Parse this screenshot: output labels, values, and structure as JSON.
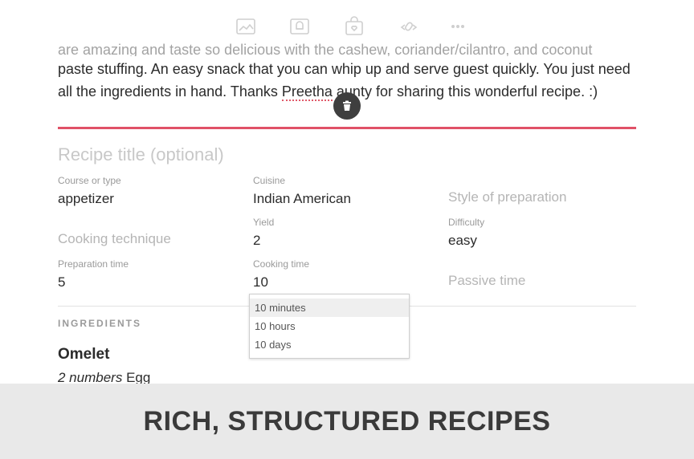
{
  "toolbar": {
    "buttons": [
      {
        "icon": "image-icon"
      },
      {
        "icon": "recipe-card-icon"
      },
      {
        "icon": "shopping-bag-icon"
      },
      {
        "icon": "link-icon"
      },
      {
        "icon": "more-icon"
      }
    ]
  },
  "paragraph": {
    "line1": "are amazing and taste so delicious with the cashew, coriander/cilantro, and coconut",
    "line2": "paste stuffing. An easy snack that you can whip up and serve guest quickly. You just need",
    "line3_before": "all the ingredients in hand. Thanks ",
    "line3_link": "Preetha",
    "line3_after": " aunty for sharing this wonderful recipe. :)"
  },
  "recipe": {
    "title_placeholder": "Recipe title (optional)",
    "course": {
      "label": "Course or type",
      "value": "appetizer"
    },
    "cuisine": {
      "label": "Cuisine",
      "value": "Indian American"
    },
    "style": {
      "placeholder": "Style of preparation"
    },
    "technique": {
      "placeholder": "Cooking technique"
    },
    "yield": {
      "label": "Yield",
      "value": "2"
    },
    "difficulty": {
      "label": "Difficulty",
      "value": "easy"
    },
    "prep_time": {
      "label": "Preparation time",
      "value": "5"
    },
    "cook_time": {
      "label": "Cooking time",
      "value": "10"
    },
    "passive_time": {
      "placeholder": "Passive time"
    }
  },
  "dropdown": {
    "options": [
      "10 minutes",
      "10 hours",
      "10 days"
    ],
    "selected_index": 0
  },
  "ingredients": {
    "heading": "INGREDIENTS",
    "group": "Omelet",
    "item": {
      "quantity": "2 numbers",
      "name": "Egg"
    }
  },
  "banner": {
    "text": "RICH, STRUCTURED RECIPES"
  },
  "colors": {
    "accent": "#e05167",
    "banner_bg": "#e9e9e9",
    "fab_bg": "#3f3f3f"
  }
}
